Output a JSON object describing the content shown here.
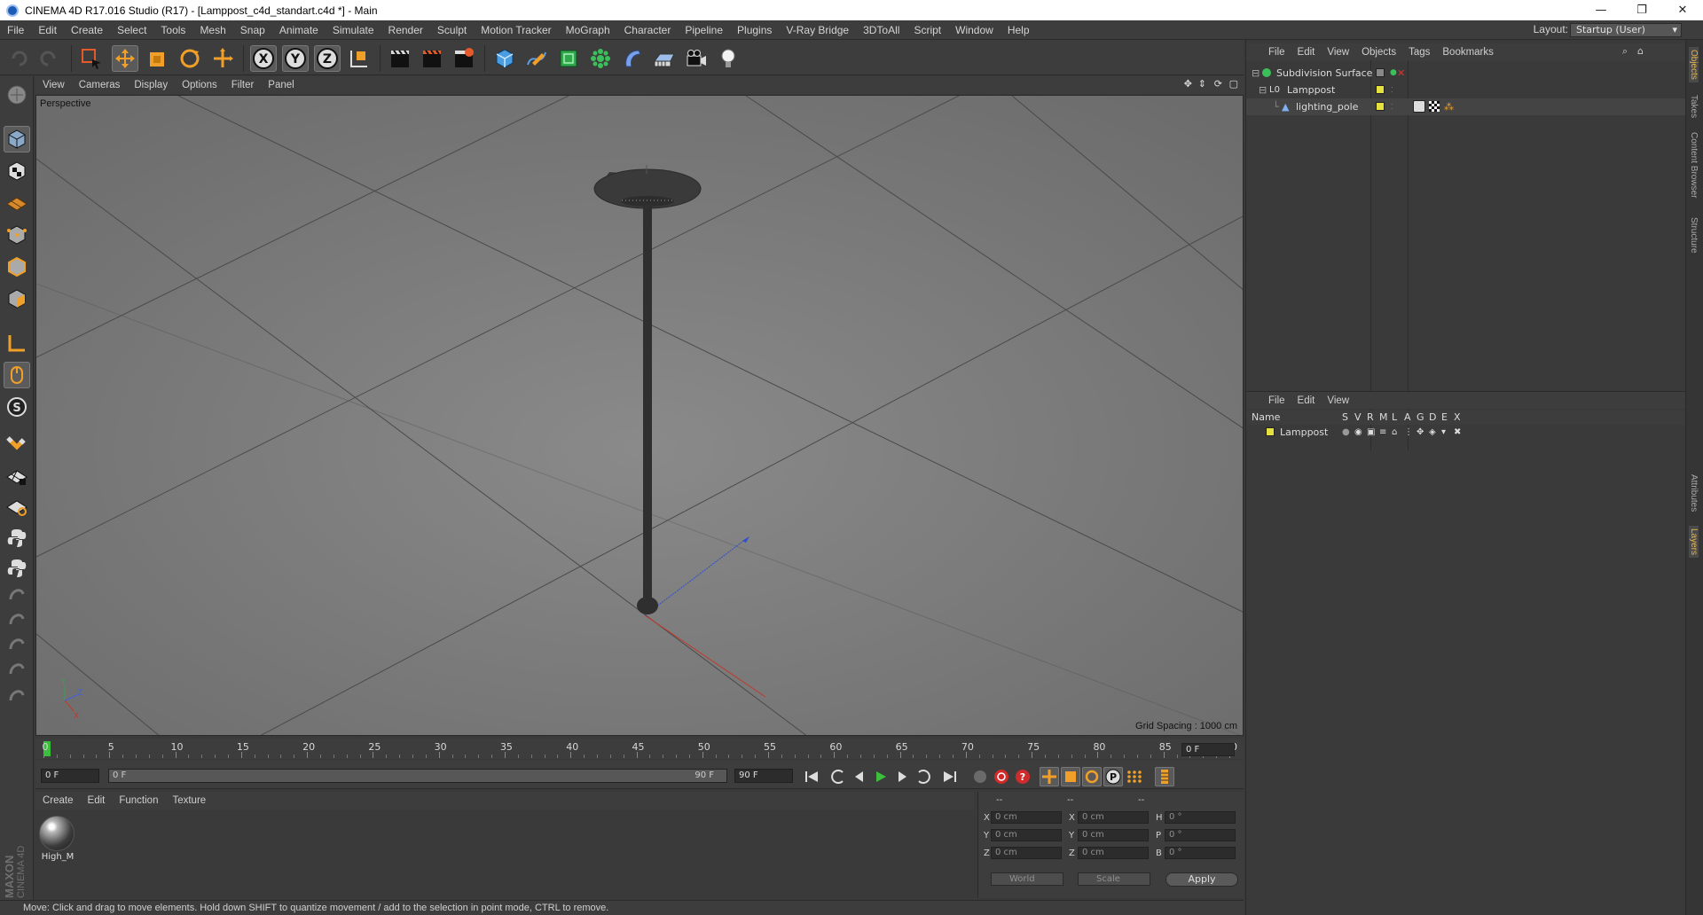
{
  "window": {
    "title": "CINEMA 4D R17.016 Studio (R17) - [Lamppost_c4d_standart.c4d *] - Main",
    "minimize": "—",
    "maximize": "❐",
    "close": "✕"
  },
  "menubar": {
    "items": [
      "File",
      "Edit",
      "Create",
      "Select",
      "Tools",
      "Mesh",
      "Snap",
      "Animate",
      "Simulate",
      "Render",
      "Sculpt",
      "Motion Tracker",
      "MoGraph",
      "Character",
      "Pipeline",
      "Plugins",
      "V-Ray Bridge",
      "3DToAll",
      "Script",
      "Window",
      "Help"
    ],
    "layout_label": "Layout:",
    "layout_value": "Startup (User)"
  },
  "viewport": {
    "menu": [
      "View",
      "Cameras",
      "Display",
      "Options",
      "Filter",
      "Panel"
    ],
    "label": "Perspective",
    "grid_spacing": "Grid Spacing : 1000 cm"
  },
  "timeline": {
    "ticks": [
      "0",
      "5",
      "10",
      "15",
      "20",
      "25",
      "30",
      "35",
      "40",
      "45",
      "50",
      "55",
      "60",
      "65",
      "70",
      "75",
      "80",
      "85",
      "90"
    ],
    "frame_field": "0 F"
  },
  "transport": {
    "start": "0 F",
    "range_start": "0 F",
    "range_end": "90 F",
    "end": "90 F"
  },
  "materials": {
    "menu": [
      "Create",
      "Edit",
      "Function",
      "Texture"
    ],
    "items": [
      {
        "name": "High_M"
      }
    ]
  },
  "coordinates": {
    "header_left": "--",
    "header_mid": "--",
    "header_right": "--",
    "pos": [
      {
        "axis": "X",
        "value": "0 cm"
      },
      {
        "axis": "Y",
        "value": "0 cm"
      },
      {
        "axis": "Z",
        "value": "0 cm"
      }
    ],
    "size": [
      {
        "axis": "X",
        "value": "0 cm"
      },
      {
        "axis": "Y",
        "value": "0 cm"
      },
      {
        "axis": "Z",
        "value": "0 cm"
      }
    ],
    "rot": [
      {
        "axis": "H",
        "value": "0 °"
      },
      {
        "axis": "P",
        "value": "0 °"
      },
      {
        "axis": "B",
        "value": "0 °"
      }
    ],
    "mode": "World",
    "scale": "Scale",
    "apply": "Apply"
  },
  "logo": {
    "line1": "MAXON",
    "line2": "CINEMA 4D"
  },
  "status": "Move: Click and drag to move elements. Hold down SHIFT to quantize movement / add to the selection in point mode, CTRL to remove.",
  "objects": {
    "menu": [
      "File",
      "Edit",
      "View",
      "Objects",
      "Tags",
      "Bookmarks"
    ],
    "rows": [
      {
        "name": "Subdivision Surface"
      },
      {
        "name": "Lamppost"
      },
      {
        "name": "lighting_pole"
      }
    ]
  },
  "layers": {
    "menu": [
      "File",
      "Edit",
      "View"
    ],
    "columns": [
      "Name",
      "S",
      "V",
      "R",
      "M",
      "L",
      "A",
      "G",
      "D",
      "E",
      "X"
    ],
    "rows": [
      {
        "name": "Lamppost"
      }
    ]
  },
  "vtabs": [
    "Objects",
    "Takes",
    "Content Browser",
    "Structure",
    "Attributes",
    "Layers"
  ]
}
